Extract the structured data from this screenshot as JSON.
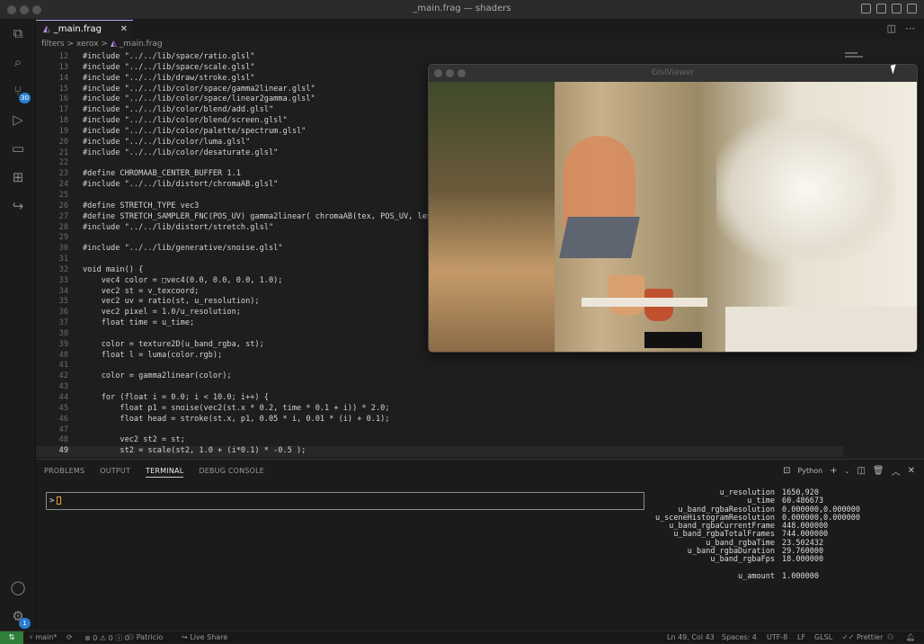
{
  "window": {
    "title": "_main.frag — shaders"
  },
  "tab": {
    "label": "_main.frag"
  },
  "breadcrumb": [
    "filters",
    ">",
    "xerox",
    ">",
    "_main.frag"
  ],
  "activity_badges": {
    "source_control": "30",
    "settings": "1"
  },
  "code_lines": [
    {
      "n": "12",
      "t": "#include \"../../lib/space/ratio.glsl\""
    },
    {
      "n": "13",
      "t": "#include \"../../lib/space/scale.glsl\""
    },
    {
      "n": "14",
      "t": "#include \"../../lib/draw/stroke.glsl\""
    },
    {
      "n": "15",
      "t": "#include \"../../lib/color/space/gamma2linear.glsl\""
    },
    {
      "n": "16",
      "t": "#include \"../../lib/color/space/linear2gamma.glsl\""
    },
    {
      "n": "17",
      "t": "#include \"../../lib/color/blend/add.glsl\""
    },
    {
      "n": "18",
      "t": "#include \"../../lib/color/blend/screen.glsl\""
    },
    {
      "n": "19",
      "t": "#include \"../../lib/color/palette/spectrum.glsl\""
    },
    {
      "n": "20",
      "t": "#include \"../../lib/color/luma.glsl\""
    },
    {
      "n": "21",
      "t": "#include \"../../lib/color/desaturate.glsl\""
    },
    {
      "n": "22",
      "t": ""
    },
    {
      "n": "23",
      "t": "#define CHROMAAB_CENTER_BUFFER 1.1"
    },
    {
      "n": "24",
      "t": "#include \"../../lib/distort/chromaAB.glsl\""
    },
    {
      "n": "25",
      "t": ""
    },
    {
      "n": "26",
      "t": "#define STRETCH_TYPE vec3"
    },
    {
      "n": "27",
      "t": "#define STRETCH_SAMPLER_FNC(POS_UV) gamma2linear( chromaAB(tex, POS_UV, length(POS_"
    },
    {
      "n": "28",
      "t": "#include \"../../lib/distort/stretch.glsl\""
    },
    {
      "n": "29",
      "t": ""
    },
    {
      "n": "30",
      "t": "#include \"../../lib/generative/snoise.glsl\""
    },
    {
      "n": "31",
      "t": ""
    },
    {
      "n": "32",
      "t": "void main() {"
    },
    {
      "n": "33",
      "t": "    vec4 color = □vec4(0.0, 0.0, 0.0, 1.0);"
    },
    {
      "n": "34",
      "t": "    vec2 st = v_texcoord;"
    },
    {
      "n": "35",
      "t": "    vec2 uv = ratio(st, u_resolution);"
    },
    {
      "n": "36",
      "t": "    vec2 pixel = 1.0/u_resolution;"
    },
    {
      "n": "37",
      "t": "    float time = u_time;"
    },
    {
      "n": "38",
      "t": ""
    },
    {
      "n": "39",
      "t": "    color = texture2D(u_band_rgba, st);"
    },
    {
      "n": "40",
      "t": "    float l = luma(color.rgb);"
    },
    {
      "n": "41",
      "t": ""
    },
    {
      "n": "42",
      "t": "    color = gamma2linear(color);"
    },
    {
      "n": "43",
      "t": ""
    },
    {
      "n": "44",
      "t": "    for (float i = 0.0; i < 10.0; i++) {"
    },
    {
      "n": "45",
      "t": "        float p1 = snoise(vec2(st.x * 0.2, time * 0.1 + i)) * 2.0;"
    },
    {
      "n": "46",
      "t": "        float head = stroke(st.x, p1, 0.05 * i, 0.01 * (i) + 0.1);"
    },
    {
      "n": "47",
      "t": ""
    },
    {
      "n": "48",
      "t": "        vec2 st2 = st;"
    },
    {
      "n": "49",
      "t": "        st2 = scale(st2, 1.0 + (i*0.1) * -0.5 );",
      "current": true
    }
  ],
  "glsl_viewer": {
    "title": "GlslViewer"
  },
  "panel": {
    "tabs": [
      "PROBLEMS",
      "OUTPUT",
      "TERMINAL",
      "DEBUG CONSOLE"
    ],
    "active_tab": "TERMINAL",
    "shell": "Python",
    "terminal_prompt": ">"
  },
  "uniforms": [
    {
      "name": "u_resolution",
      "value": "1650,920"
    },
    {
      "name": "u_time",
      "value": "60.486673"
    },
    {
      "name": "u_band_rgbaResolution",
      "value": "0.000000,0.000000"
    },
    {
      "name": "u_sceneHistogramResolution",
      "value": "0.000000,0.000000"
    },
    {
      "name": "u_band_rgbaCurrentFrame",
      "value": "448.000000"
    },
    {
      "name": "u_band_rgbaTotalFrames",
      "value": "744.000000"
    },
    {
      "name": "u_band_rgbaTime",
      "value": "23.502432"
    },
    {
      "name": "u_band_rgbaDuration",
      "value": "29.760000"
    },
    {
      "name": "u_band_rgbaFps",
      "value": "18.000000"
    },
    {
      "name": "",
      "value": ""
    },
    {
      "name": "u_amount",
      "value": "1.000000"
    }
  ],
  "status": {
    "branch": "main*",
    "errors": "0",
    "warnings": "0",
    "infos": "0",
    "user": "Patricio",
    "live_share": "Live Share",
    "position": "Ln 49, Col 43",
    "spaces": "Spaces: 4",
    "encoding": "UTF-8",
    "eol": "LF",
    "language": "GLSL",
    "formatter": "Prettier"
  }
}
